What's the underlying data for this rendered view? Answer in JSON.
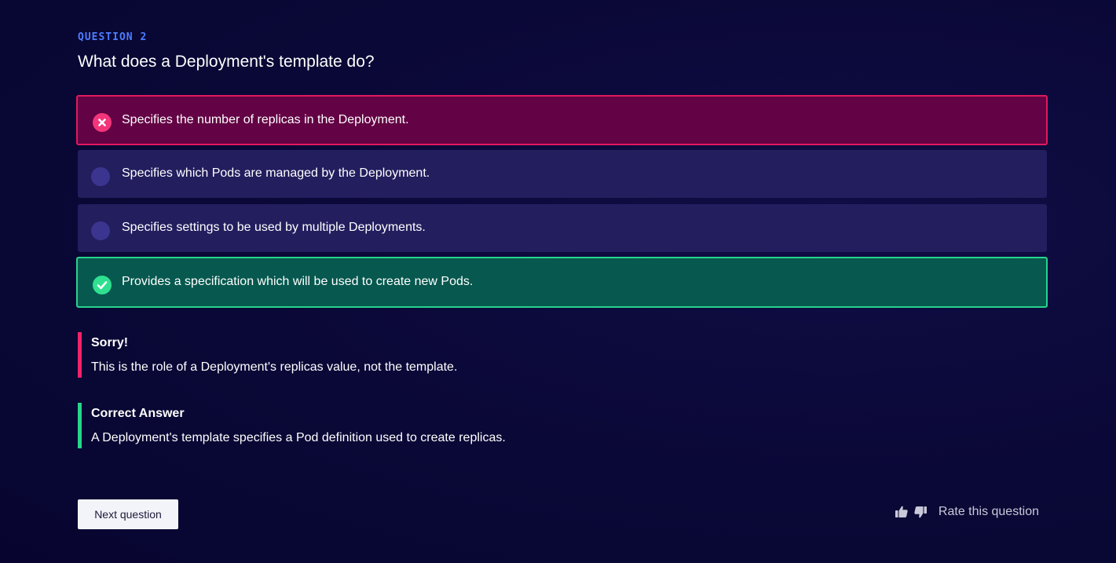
{
  "question": {
    "kicker": "QUESTION 2",
    "title": "What does a Deployment's template do?"
  },
  "options": [
    {
      "label": "Specifies the number of replicas in the Deployment.",
      "state": "wrong"
    },
    {
      "label": "Specifies which Pods are managed by the Deployment.",
      "state": "neutral"
    },
    {
      "label": "Specifies settings to be used by multiple Deployments.",
      "state": "neutral"
    },
    {
      "label": "Provides a specification which will be used to create new Pods.",
      "state": "correct"
    }
  ],
  "feedback": {
    "sorry": {
      "heading": "Sorry!",
      "body": "This is the role of a Deployment's replicas value, not the template."
    },
    "correct": {
      "heading": "Correct Answer",
      "body": "A Deployment's template specifies a Pod definition used to create replicas."
    }
  },
  "footer": {
    "next_label": "Next question",
    "rate_label": "Rate this question",
    "thumbs_up_icon": "thumbs-up-icon",
    "thumbs_down_icon": "thumbs-down-icon"
  },
  "colors": {
    "background": "#0a0836",
    "kicker": "#4d7dff",
    "wrong_border": "#e0195f",
    "wrong_bg": "#630244",
    "correct_border": "#26d48c",
    "correct_bg": "#07584f",
    "neutral_bg": "#231e5e"
  }
}
